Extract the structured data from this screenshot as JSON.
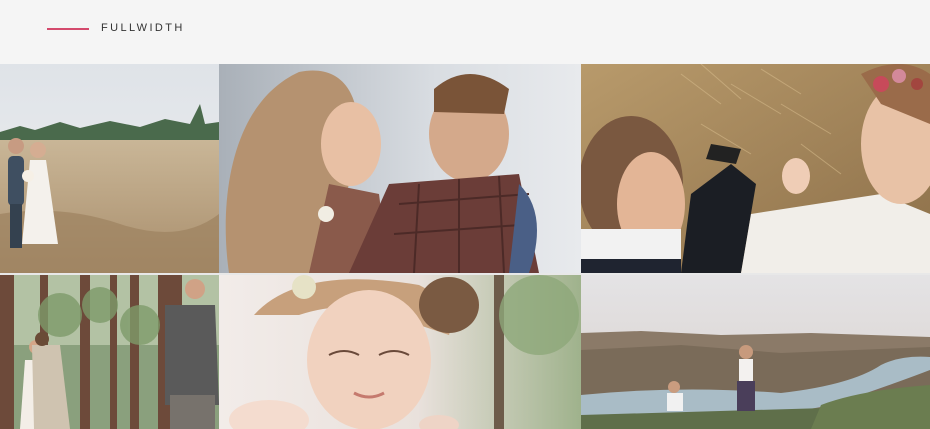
{
  "header": {
    "title": "FULLWIDTH",
    "accent_color": "#d44a6d"
  },
  "gallery": {
    "items": [
      {
        "subject": "couple-in-field-photo"
      },
      {
        "subject": "couple-embrace-photo"
      },
      {
        "subject": "couple-holding-hands-photo"
      },
      {
        "subject": "couple-in-forest-photo"
      },
      {
        "subject": "bride-portrait-photo"
      },
      {
        "subject": "proposal-canyon-photo"
      }
    ]
  }
}
